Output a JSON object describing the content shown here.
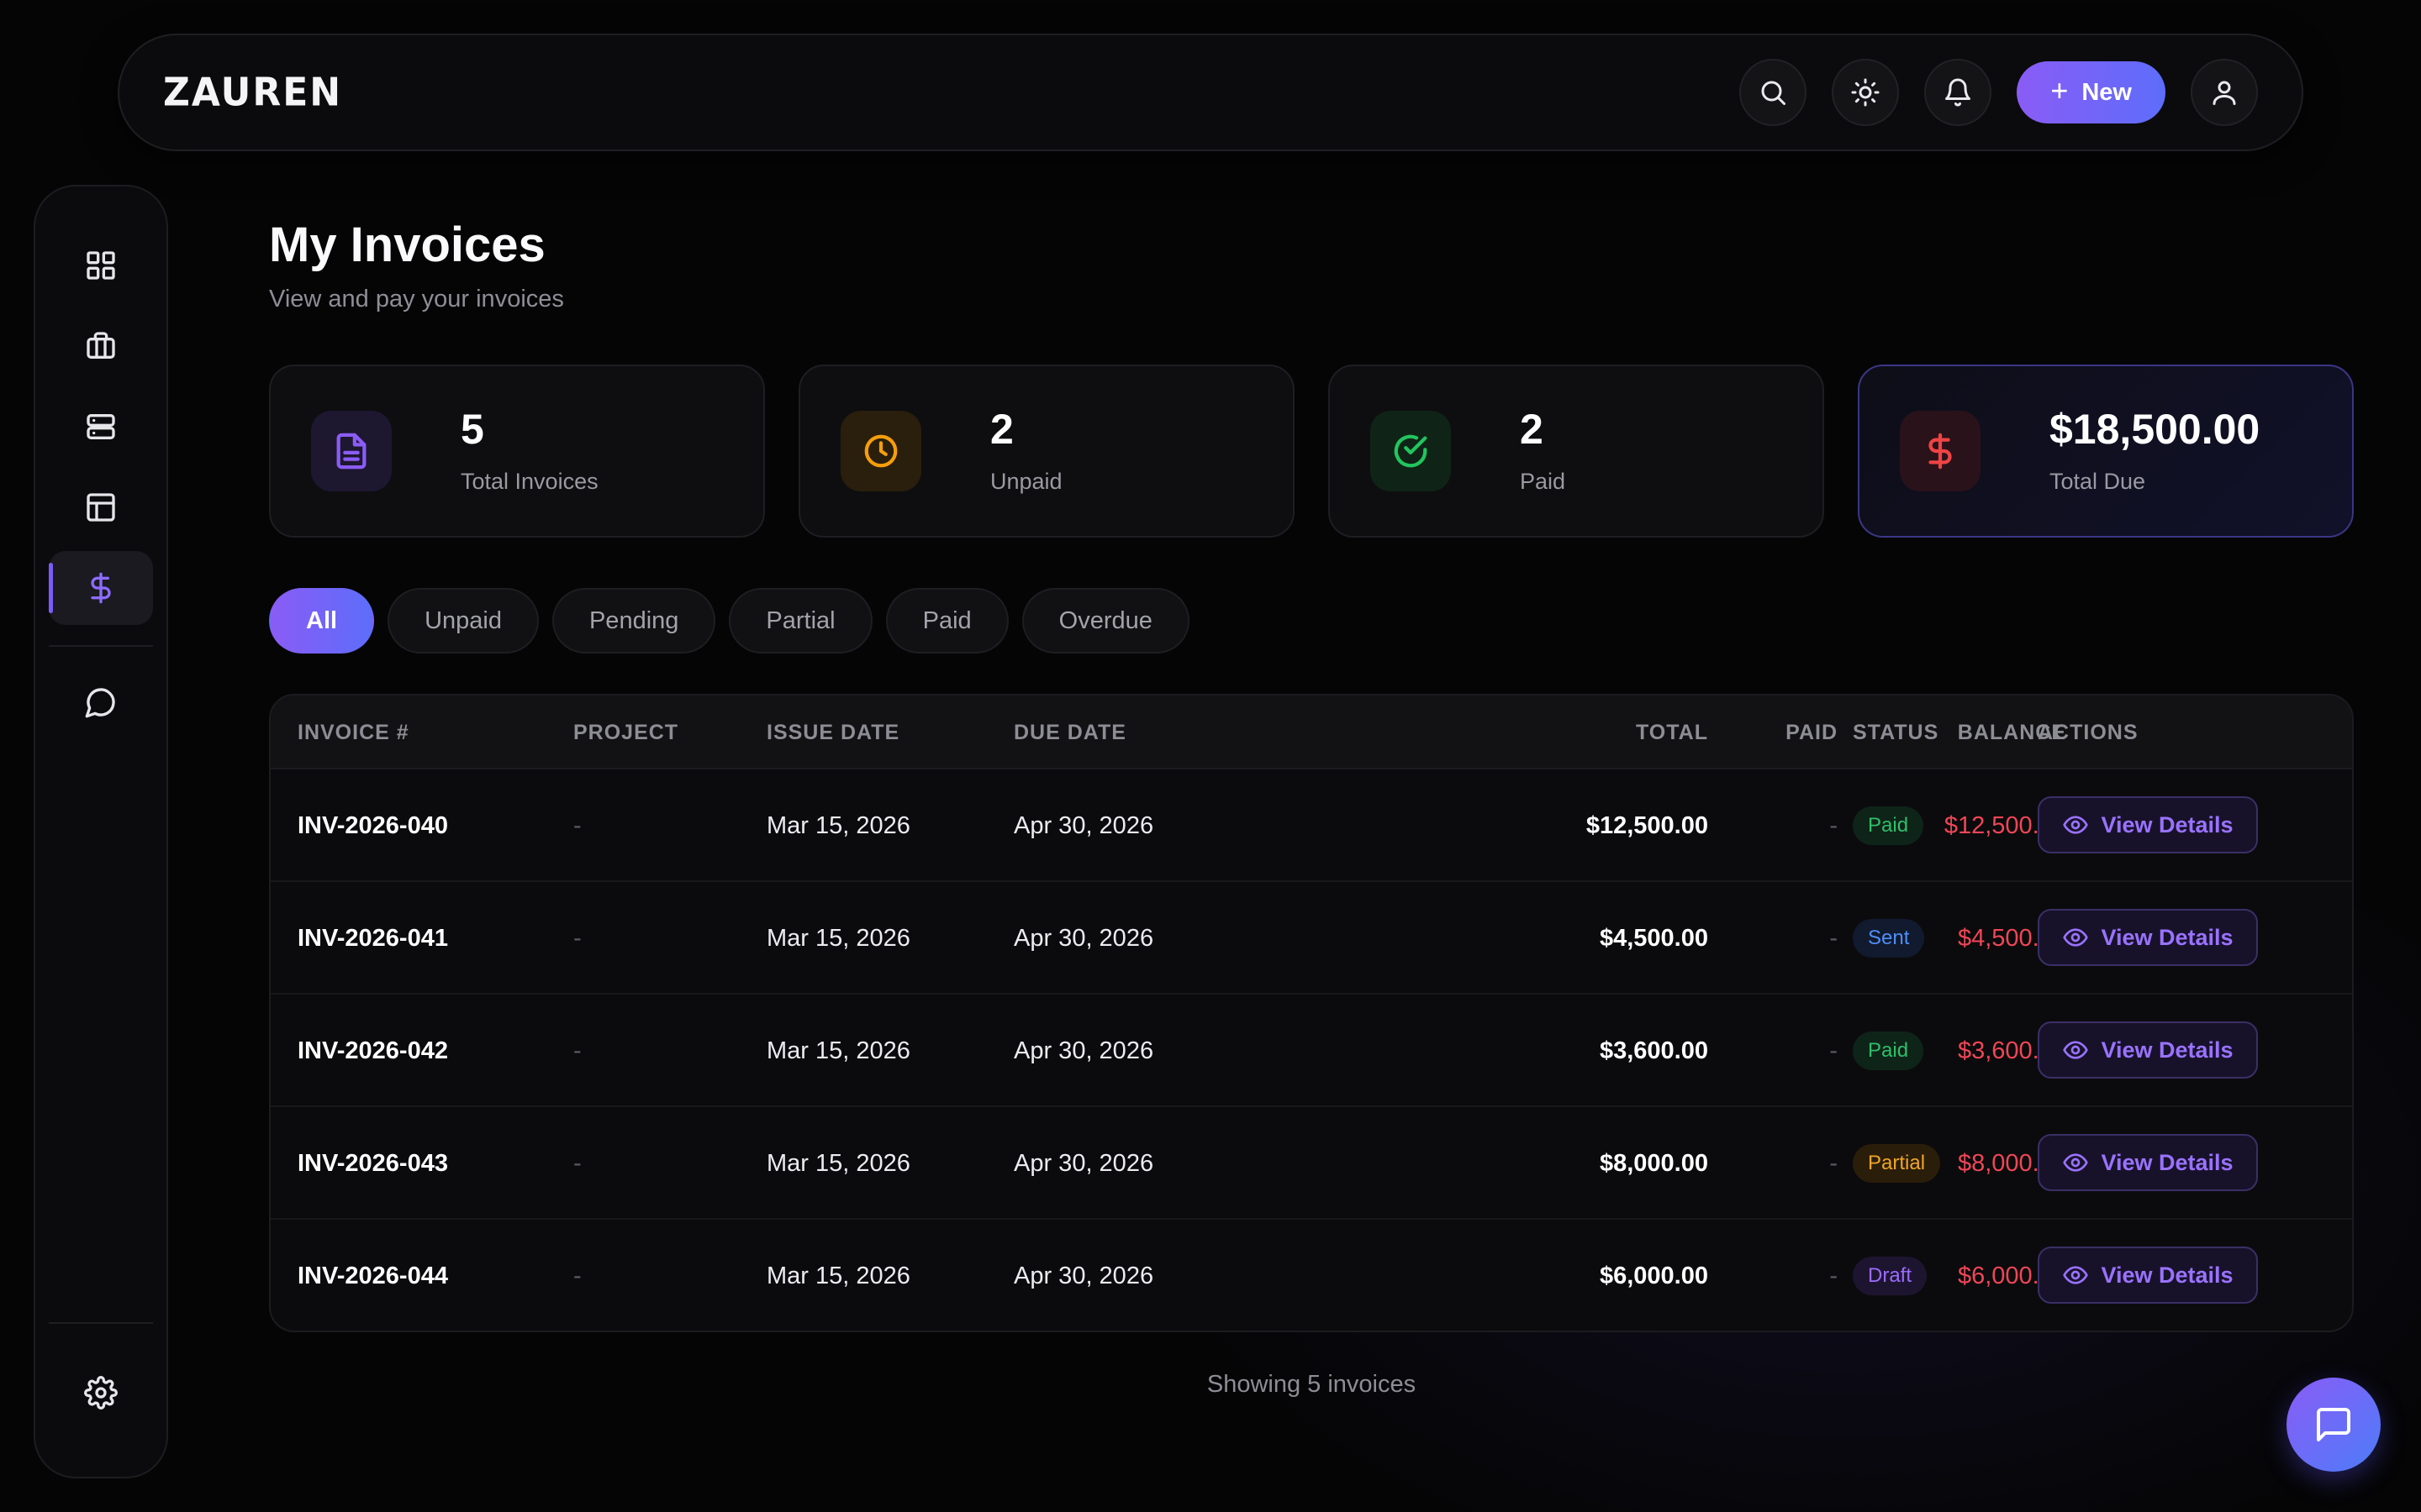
{
  "brand": {
    "logo": "ZAUREN"
  },
  "topbar": {
    "new_label": "New",
    "icons": [
      "search-icon",
      "sun-icon",
      "bell-icon",
      "plus-icon",
      "user-icon"
    ]
  },
  "sidebar": {
    "items": [
      {
        "icon": "grid-icon",
        "active": false
      },
      {
        "icon": "briefcase-icon",
        "active": false
      },
      {
        "icon": "server-icon",
        "active": false
      },
      {
        "icon": "layout-icon",
        "active": false
      },
      {
        "icon": "dollar-icon",
        "active": true
      },
      {
        "icon": "message-icon",
        "active": false
      },
      {
        "icon": "settings-icon",
        "active": false
      }
    ]
  },
  "page": {
    "title": "My Invoices",
    "subtitle": "View and pay your invoices"
  },
  "stats": [
    {
      "value": "5",
      "label": "Total Invoices",
      "icon": "file-text-icon",
      "color": "#8b5cf6"
    },
    {
      "value": "2",
      "label": "Unpaid",
      "icon": "clock-icon",
      "color": "#f59e0b"
    },
    {
      "value": "2",
      "label": "Paid",
      "icon": "check-circle-icon",
      "color": "#22c55e"
    },
    {
      "value": "$18,500.00",
      "label": "Total Due",
      "icon": "dollar-icon",
      "color": "#ef4444"
    }
  ],
  "filters": [
    "All",
    "Unpaid",
    "Pending",
    "Partial",
    "Paid",
    "Overdue"
  ],
  "active_filter": "All",
  "table": {
    "headers": [
      "INVOICE #",
      "PROJECT",
      "ISSUE DATE",
      "DUE DATE",
      "TOTAL",
      "PAID",
      "BALANCE",
      "STATUS",
      "ACTIONS"
    ],
    "rows": [
      {
        "invoice": "INV-2026-040",
        "project": "-",
        "issue": "Mar 15, 2026",
        "due": "Apr 30, 2026",
        "total": "$12,500.00",
        "paid": "-",
        "balance": "$12,500.00",
        "status": "Paid",
        "action": "View Details"
      },
      {
        "invoice": "INV-2026-041",
        "project": "-",
        "issue": "Mar 15, 2026",
        "due": "Apr 30, 2026",
        "total": "$4,500.00",
        "paid": "-",
        "balance": "$4,500.00",
        "status": "Sent",
        "action": "View Details"
      },
      {
        "invoice": "INV-2026-042",
        "project": "-",
        "issue": "Mar 15, 2026",
        "due": "Apr 30, 2026",
        "total": "$3,600.00",
        "paid": "-",
        "balance": "$3,600.00",
        "status": "Paid",
        "action": "View Details"
      },
      {
        "invoice": "INV-2026-043",
        "project": "-",
        "issue": "Mar 15, 2026",
        "due": "Apr 30, 2026",
        "total": "$8,000.00",
        "paid": "-",
        "balance": "$8,000.00",
        "status": "Partial",
        "action": "View Details"
      },
      {
        "invoice": "INV-2026-044",
        "project": "-",
        "issue": "Mar 15, 2026",
        "due": "Apr 30, 2026",
        "total": "$6,000.00",
        "paid": "-",
        "balance": "$6,000.00",
        "status": "Draft",
        "action": "View Details"
      }
    ]
  },
  "footer": {
    "note": "Showing 5 invoices"
  },
  "colors": {
    "accent_start": "#8a5cf6",
    "accent_end": "#5d6dfa",
    "balance": "#ef4656",
    "status_paid": "#2fbf6a",
    "status_sent": "#4f8ef7",
    "status_partial": "#f0a527",
    "status_draft": "#9b6bff"
  }
}
